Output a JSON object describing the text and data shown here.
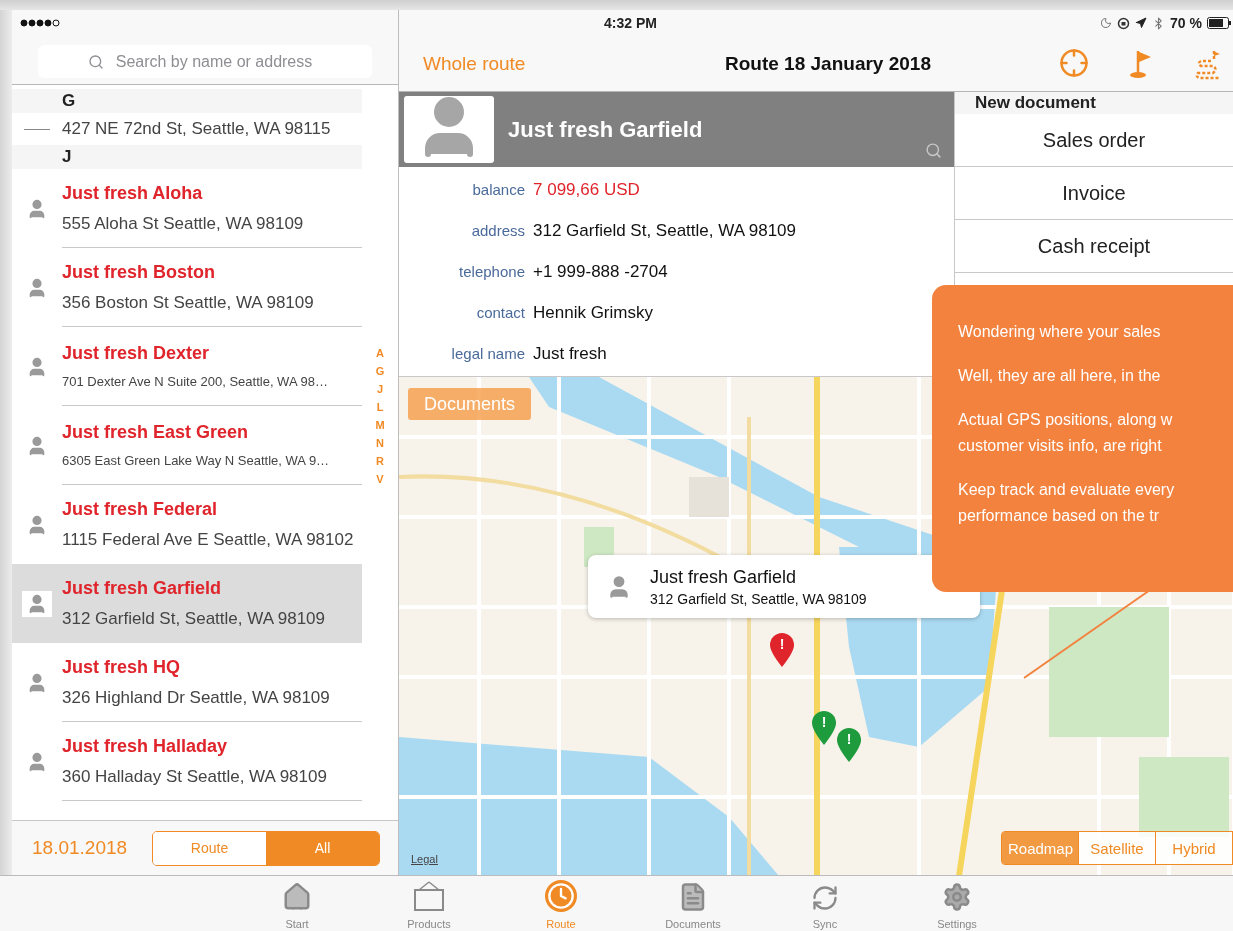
{
  "status_bar": {
    "time": "4:32 PM",
    "battery": "70 %"
  },
  "search": {
    "placeholder": "Search by name or address"
  },
  "customers": [
    {
      "kind": "section",
      "label": "G",
      "selected": false
    },
    {
      "kind": "customer",
      "address": "427 NE 72nd St, Seattle, WA 98115",
      "selected": false
    },
    {
      "kind": "section",
      "label": "J",
      "selected": false
    },
    {
      "kind": "customer",
      "name": "Just fresh Aloha",
      "address": "555 Aloha St Seattle, WA 98109",
      "selected": false
    },
    {
      "kind": "customer",
      "name": "Just fresh Boston",
      "address": "356 Boston St Seattle, WA 98109",
      "selected": false
    },
    {
      "kind": "customer",
      "name": "Just fresh Dexter",
      "address": "701 Dexter Ave N Suite 200, Seattle, WA 98…",
      "selected": false
    },
    {
      "kind": "customer",
      "name": "Just fresh East Green",
      "address": "6305 East Green Lake Way N Seattle, WA 9…",
      "selected": false
    },
    {
      "kind": "customer",
      "name": "Just fresh Federal",
      "address": "1115 Federal Ave E Seattle, WA 98102",
      "selected": false
    },
    {
      "kind": "customer",
      "name": "Just fresh Garfield",
      "address": "312 Garfield St, Seattle, WA 98109",
      "selected": true
    },
    {
      "kind": "customer",
      "name": "Just fresh HQ",
      "address": "326 Highland Dr Seattle, WA 98109",
      "selected": false
    },
    {
      "kind": "customer",
      "name": "Just fresh Halladay",
      "address": "360 Halladay St Seattle, WA 98109",
      "selected": false
    }
  ],
  "index_letters": [
    "A",
    "G",
    "J",
    "L",
    "M",
    "N",
    "R",
    "V"
  ],
  "list_footer": {
    "date": "18.01.2018",
    "filters": [
      {
        "label": "Route",
        "selected": false
      },
      {
        "label": "All",
        "selected": true
      }
    ]
  },
  "nav": {
    "back": "Whole route",
    "title": "Route 18 January 2018"
  },
  "customer_card": {
    "name": "Just fresh Garfield",
    "fields": [
      {
        "label": "balance",
        "value": "7 099,66 USD",
        "highlight": true
      },
      {
        "label": "address",
        "value": "312 Garfield St, Seattle, WA 98109",
        "highlight": false
      },
      {
        "label": "telephone",
        "value": "+1 999-888 -2704",
        "highlight": false
      },
      {
        "label": "contact",
        "value": "Hennik Grimsky",
        "highlight": false
      },
      {
        "label": "legal name",
        "value": "Just fresh",
        "highlight": false
      }
    ]
  },
  "new_document": {
    "title": "New document",
    "items": [
      "Sales order",
      "Invoice",
      "Cash receipt"
    ]
  },
  "map": {
    "documents_button": "Documents",
    "legal": "Legal",
    "callout": {
      "name": "Just fresh Garfield",
      "address": "312 Garfield St, Seattle, WA 98109"
    },
    "pins": [
      {
        "mark": "!",
        "color": "#e0242b"
      },
      {
        "mark": "!",
        "color": "#1e9b3c"
      },
      {
        "mark": "!",
        "color": "#1e9b3c"
      }
    ],
    "map_types": [
      {
        "label": "Roadmap",
        "selected": true
      },
      {
        "label": "Satellite",
        "selected": false
      },
      {
        "label": "Hybrid",
        "selected": false
      }
    ]
  },
  "tooltip": {
    "paragraphs": [
      {
        "lines": [
          "Wondering where your sales"
        ]
      },
      {
        "lines": [
          "Well, they are all here, in the"
        ]
      },
      {
        "lines": [
          "Actual GPS positions, along w",
          "customer visits info, are right"
        ]
      },
      {
        "lines": [
          "Keep track and evaluate every",
          "performance based on the tr"
        ]
      }
    ]
  },
  "tab_bar": [
    {
      "kind": "home",
      "label": "Start",
      "selected": false
    },
    {
      "kind": "products",
      "label": "Products",
      "selected": false
    },
    {
      "kind": "route",
      "label": "Route",
      "selected": true
    },
    {
      "kind": "documents",
      "label": "Documents",
      "selected": false
    },
    {
      "kind": "sync",
      "label": "Sync",
      "selected": false
    },
    {
      "kind": "settings",
      "label": "Settings",
      "selected": false
    }
  ]
}
